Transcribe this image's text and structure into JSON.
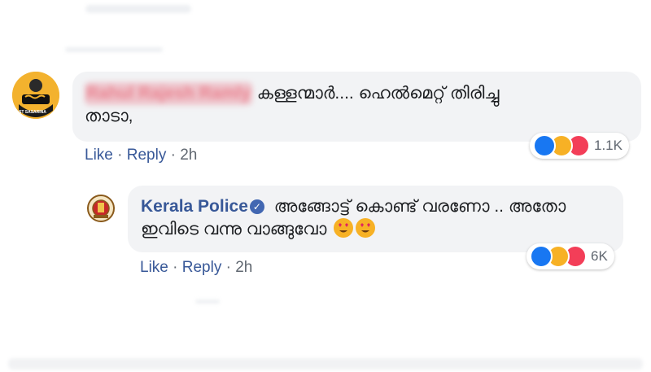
{
  "comments": [
    {
      "author": "Rahul Rajesh Ramly",
      "text": "കള്ളന്മാർ.... ഹെൽമെറ്റ് തിരിച്ചു താടാ,",
      "actions": {
        "like": "Like",
        "reply": "Reply",
        "time": "2h"
      },
      "reactions": {
        "types": [
          "like-icon",
          "haha-icon",
          "love-icon"
        ],
        "count": "1.1K"
      },
      "avatar_text": "ST SASARINA"
    },
    {
      "author": "Kerala Police",
      "verified": true,
      "text": "അങ്ങോട്ട് കൊണ്ട് വരണോ .. അതോ ഇവിടെ വന്നു വാങ്ങുവോ",
      "emoji": [
        "heart-eyes-emoji",
        "heart-eyes-emoji"
      ],
      "actions": {
        "like": "Like",
        "reply": "Reply",
        "time": "2h"
      },
      "reactions": {
        "types": [
          "like-icon",
          "haha-icon",
          "love-icon"
        ],
        "count": "6K"
      }
    }
  ],
  "separator": "·",
  "colors": {
    "link": "#385898",
    "bubble": "#f2f3f5",
    "like": "#1877f2",
    "haha": "#f7b125",
    "love": "#f33e58"
  }
}
